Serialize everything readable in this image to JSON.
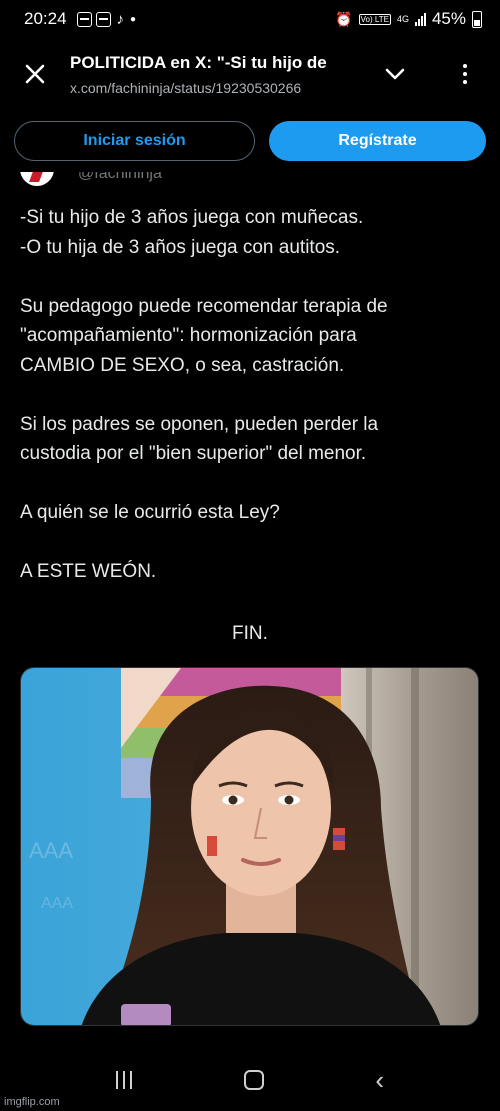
{
  "status_bar": {
    "time": "20:24",
    "volte": "Vo) LTE",
    "network": "4G",
    "battery": "45%"
  },
  "tab": {
    "title": "POLITICIDA en X: \"-Si tu hijo de",
    "url": "x.com/fachininja/status/19230530266"
  },
  "auth": {
    "login_label": "Iniciar sesión",
    "signup_label": "Regístrate"
  },
  "author": {
    "handle": "@fachininja"
  },
  "tweet": {
    "line1": "-Si tu hijo de 3 años juega con muñecas.",
    "line2": "-O tu hija de 3 años juega con autitos.",
    "line3": "Su pedagogo puede recomendar terapia de",
    "line4": "\"acompañamiento\": hormonización para",
    "line5": "CAMBIO DE SEXO, o sea, castración.",
    "line6": "Si los padres se oponen, pueden perder la",
    "line7": "custodia por el \"bien superior\" del menor.",
    "line8": "A quién se le ocurrió esta Ley?",
    "line9": "A ESTE WEÓN.",
    "fin": "FIN."
  },
  "colors": {
    "accent": "#1d9bf0",
    "background": "#000000",
    "text": "#e7e9ea",
    "muted": "#71767b"
  },
  "icons": {
    "close": "close-icon",
    "dropdown": "chevron-down-icon",
    "menu": "more-vertical-icon"
  },
  "watermark": "imgflip.com"
}
